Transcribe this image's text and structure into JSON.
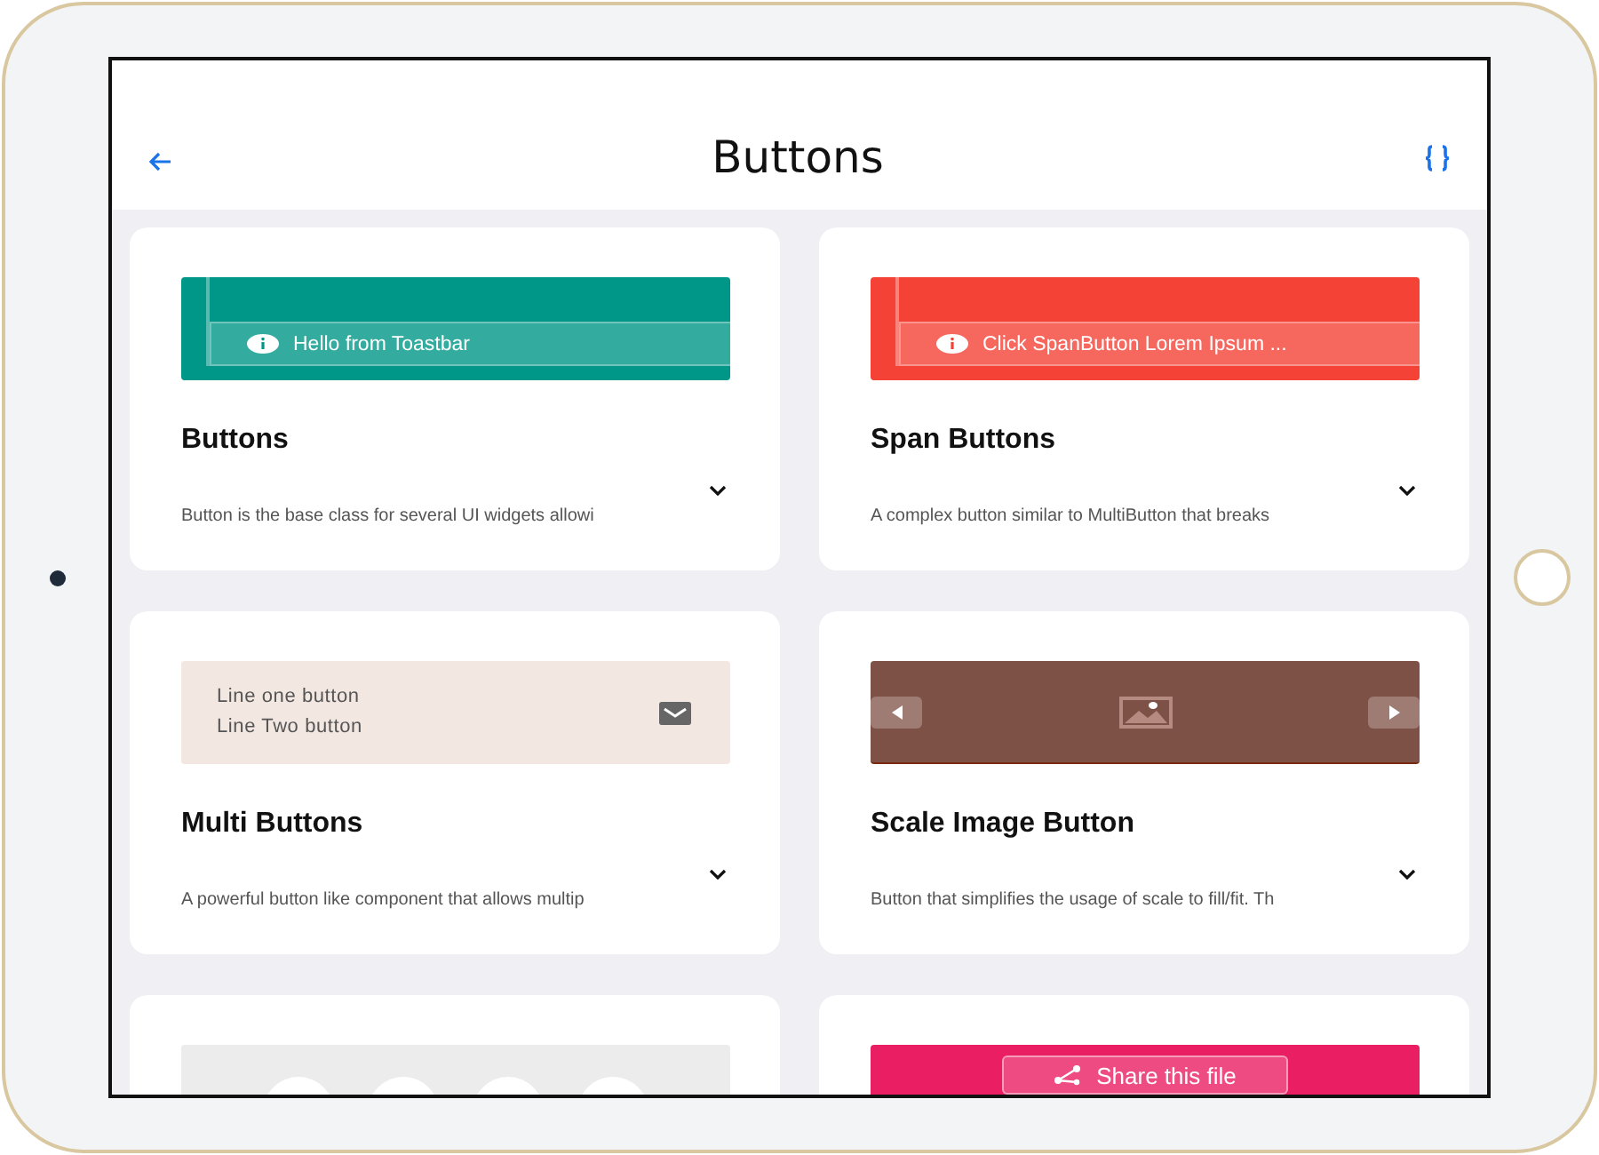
{
  "header": {
    "title": "Buttons"
  },
  "cards": [
    {
      "title": "Buttons",
      "description": "Button is the base class for several UI widgets allowi",
      "preview": {
        "kind": "toast",
        "color": "#009688",
        "text": "Hello from Toastbar"
      }
    },
    {
      "title": "Span Buttons",
      "description": "A complex button similar to MultiButton that breaks",
      "preview": {
        "kind": "toast",
        "color": "#f44336",
        "text": "Click SpanButton Lorem Ipsum ..."
      }
    },
    {
      "title": "Multi Buttons",
      "description": "A powerful button like component that allows multip",
      "preview": {
        "kind": "multi",
        "color": "#f3e7e2",
        "lines": [
          "Line one button",
          "Line Two button"
        ]
      }
    },
    {
      "title": "Scale Image Button",
      "description": "Button that simplifies the usage of scale to fill/fit. Th",
      "preview": {
        "kind": "scale",
        "color": "#7e5146"
      }
    },
    {
      "preview": {
        "kind": "toolbar",
        "color": "#ececec"
      }
    },
    {
      "preview": {
        "kind": "share",
        "color": "#e91e63",
        "text": "Share this file"
      }
    }
  ]
}
